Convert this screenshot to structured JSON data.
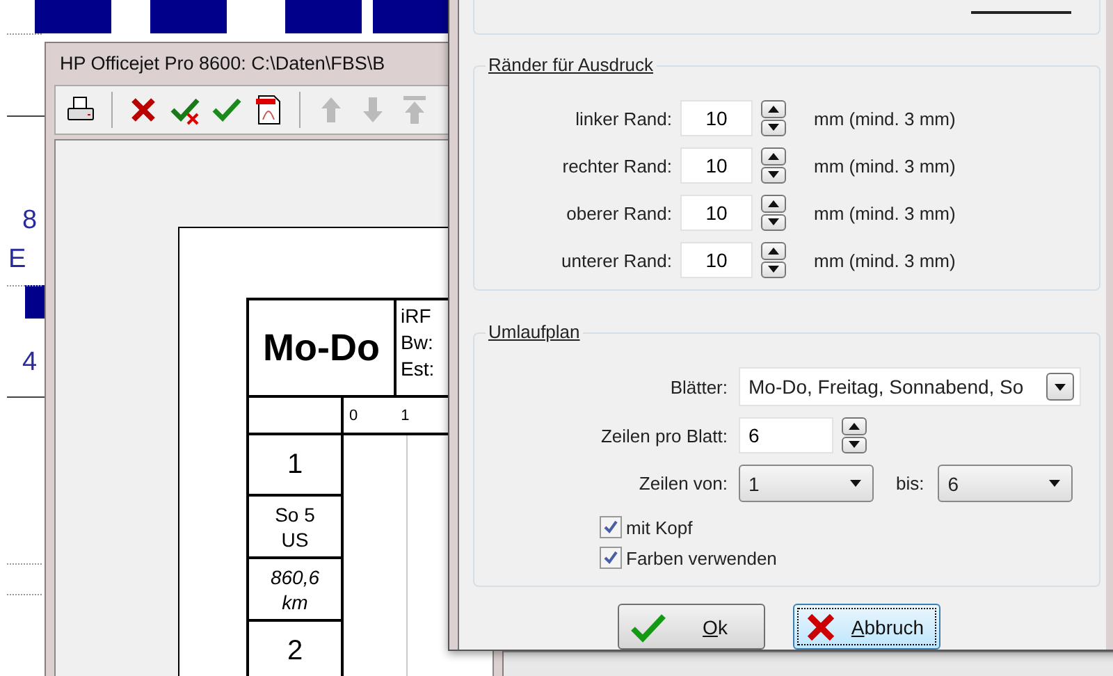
{
  "background": {
    "labels": [
      {
        "text": "8"
      },
      {
        "text": "E"
      },
      {
        "text": "4"
      }
    ]
  },
  "preview_window": {
    "title": "HP Officejet Pro 8600: C:\\Daten\\FBS\\B",
    "toolbar": [
      {
        "items": [
          {
            "kind": "print",
            "disabled": false
          }
        ]
      },
      {
        "items": [
          {
            "kind": "delete",
            "disabled": false
          },
          {
            "kind": "check-cross",
            "disabled": false
          },
          {
            "kind": "check",
            "disabled": false
          },
          {
            "kind": "pdf",
            "disabled": false
          }
        ]
      },
      {
        "items": [
          {
            "kind": "up",
            "disabled": true
          },
          {
            "kind": "down",
            "disabled": true
          },
          {
            "kind": "top",
            "disabled": true
          }
        ]
      }
    ],
    "sheet": {
      "title": "Mo-Do",
      "info": [
        "iRF",
        "Bw:",
        "Est:"
      ],
      "ticks": [
        "0",
        "1"
      ],
      "rows": [
        {
          "kind": "number",
          "lines": [
            "1"
          ]
        },
        {
          "kind": "text",
          "lines": [
            "So 5",
            "US"
          ]
        },
        {
          "kind": "distance",
          "lines": [
            "860,6",
            "km"
          ]
        },
        {
          "kind": "number",
          "lines": [
            "2"
          ]
        }
      ]
    }
  },
  "dialog": {
    "margins": {
      "title": "Ränder für Ausdruck",
      "rows": [
        {
          "label": "linker Rand:",
          "value": "10",
          "unit": "mm (mind. 3 mm)"
        },
        {
          "label": "rechter Rand:",
          "value": "10",
          "unit": "mm (mind. 3 mm)"
        },
        {
          "label": "oberer Rand:",
          "value": "10",
          "unit": "mm (mind. 3 mm)"
        },
        {
          "label": "unterer Rand:",
          "value": "10",
          "unit": "mm (mind. 3 mm)"
        }
      ]
    },
    "plan": {
      "title": "Umlaufplan",
      "sheets": {
        "label": "Blätter:",
        "value": "Mo-Do, Freitag, Sonnabend, So"
      },
      "rows_per_sheet": {
        "label": "Zeilen pro Blatt:",
        "value": "6"
      },
      "rows_from": {
        "label": "Zeilen von:",
        "value": "1"
      },
      "rows_to": {
        "label": "bis:",
        "value": "6"
      },
      "checkboxes": [
        {
          "label": "mit Kopf",
          "checked": true
        },
        {
          "label": "Farben verwenden",
          "checked": true
        }
      ]
    },
    "buttons": [
      {
        "kind": "ok",
        "label": "Ok",
        "focused": false
      },
      {
        "kind": "cancel",
        "label": "Abbruch",
        "focused": true
      }
    ]
  }
}
